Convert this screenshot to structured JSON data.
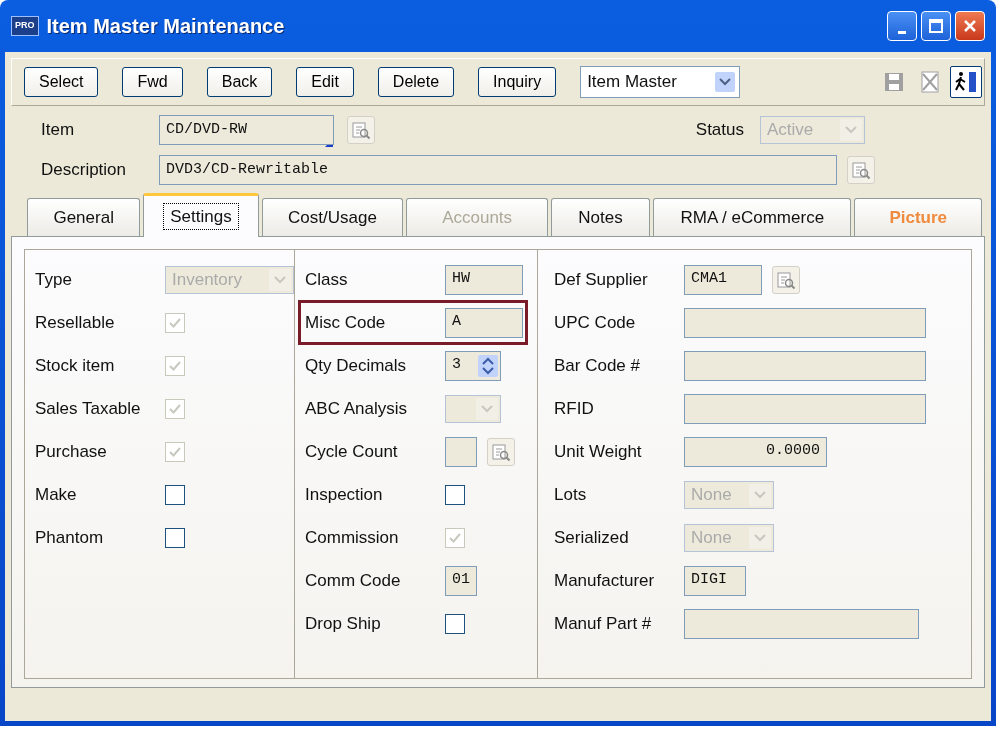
{
  "window": {
    "badge": "PRO",
    "title": "Item Master Maintenance"
  },
  "toolbar": {
    "buttons": [
      {
        "label": "Select"
      },
      {
        "label": "Fwd"
      },
      {
        "label": "Back"
      },
      {
        "label": "Edit"
      },
      {
        "label": "Delete"
      },
      {
        "label": "Inquiry"
      }
    ],
    "view": {
      "value": "Item Master"
    },
    "tools": [
      {
        "kind": "save",
        "disabled": true
      },
      {
        "kind": "cancel",
        "disabled": true
      },
      {
        "kind": "exit",
        "disabled": false
      }
    ]
  },
  "header": {
    "item": {
      "label": "Item",
      "value": "CD/DVD-RW"
    },
    "status": {
      "label": "Status",
      "value": "Active",
      "disabled": true
    },
    "description": {
      "label": "Description",
      "value": "DVD3/CD-Rewritable"
    }
  },
  "tabs": [
    {
      "label": "General",
      "selected": false,
      "disabled": false,
      "emphasized": false
    },
    {
      "label": "Settings",
      "selected": true,
      "disabled": false,
      "emphasized": false
    },
    {
      "label": "Cost/Usage",
      "selected": false,
      "disabled": false,
      "emphasized": false
    },
    {
      "label": "Accounts",
      "selected": false,
      "disabled": true,
      "emphasized": false
    },
    {
      "label": "Notes",
      "selected": false,
      "disabled": false,
      "emphasized": false
    },
    {
      "label": "RMA / eCommerce",
      "selected": false,
      "disabled": false,
      "emphasized": false
    },
    {
      "label": "Picture",
      "selected": false,
      "disabled": false,
      "emphasized": true
    }
  ],
  "columns": [
    [
      {
        "label": "Type",
        "kind": "dropdown",
        "value": "Inventory",
        "disabled": true,
        "highlighted": false
      },
      {
        "label": "Resellable",
        "kind": "checkbox",
        "checked": true,
        "disabled": true,
        "highlighted": false
      },
      {
        "label": "Stock item",
        "kind": "checkbox",
        "checked": true,
        "disabled": true,
        "highlighted": false
      },
      {
        "label": "Sales Taxable",
        "kind": "checkbox",
        "checked": true,
        "disabled": true,
        "highlighted": false
      },
      {
        "label": "Purchase",
        "kind": "checkbox",
        "checked": true,
        "disabled": true,
        "highlighted": false
      },
      {
        "label": "Make",
        "kind": "checkbox",
        "checked": false,
        "disabled": false,
        "highlighted": false
      },
      {
        "label": "Phantom",
        "kind": "checkbox",
        "checked": false,
        "disabled": false,
        "highlighted": false
      }
    ],
    [
      {
        "label": "Class",
        "kind": "text",
        "value": "HW",
        "highlighted": false
      },
      {
        "label": "Misc Code",
        "kind": "text",
        "value": "A",
        "highlighted": true
      },
      {
        "label": "Qty Decimals",
        "kind": "spinner",
        "value": "3",
        "highlighted": false
      },
      {
        "label": "ABC Analysis",
        "kind": "dropdown",
        "disabled": true,
        "highlighted": false
      },
      {
        "label": "Cycle Count",
        "kind": "lookup",
        "highlighted": false
      },
      {
        "label": "Inspection",
        "kind": "checkbox",
        "checked": false,
        "disabled": false,
        "highlighted": false
      },
      {
        "label": "Commission",
        "kind": "checkbox",
        "checked": true,
        "disabled": true,
        "highlighted": false
      },
      {
        "label": "Comm Code",
        "kind": "text",
        "value": "01",
        "highlighted": false
      },
      {
        "label": "Drop Ship",
        "kind": "checkbox",
        "checked": false,
        "disabled": false,
        "highlighted": false
      }
    ],
    [
      {
        "label": "Def Supplier",
        "kind": "lookup",
        "value": "CMA1",
        "highlighted": false
      },
      {
        "label": "UPC Code",
        "kind": "text",
        "highlighted": false
      },
      {
        "label": "Bar Code #",
        "kind": "text",
        "highlighted": false
      },
      {
        "label": "RFID",
        "kind": "text",
        "highlighted": false
      },
      {
        "label": "Unit Weight",
        "kind": "number",
        "value": "0.0000",
        "highlighted": false
      },
      {
        "label": "Lots",
        "kind": "dropdown",
        "value": "None",
        "disabled": true,
        "highlighted": false
      },
      {
        "label": "Serialized",
        "kind": "dropdown",
        "value": "None",
        "disabled": true,
        "highlighted": false
      },
      {
        "label": "Manufacturer",
        "kind": "text",
        "value": "DIGI",
        "highlighted": false
      },
      {
        "label": "Manuf Part #",
        "kind": "text",
        "highlighted": false
      }
    ]
  ]
}
